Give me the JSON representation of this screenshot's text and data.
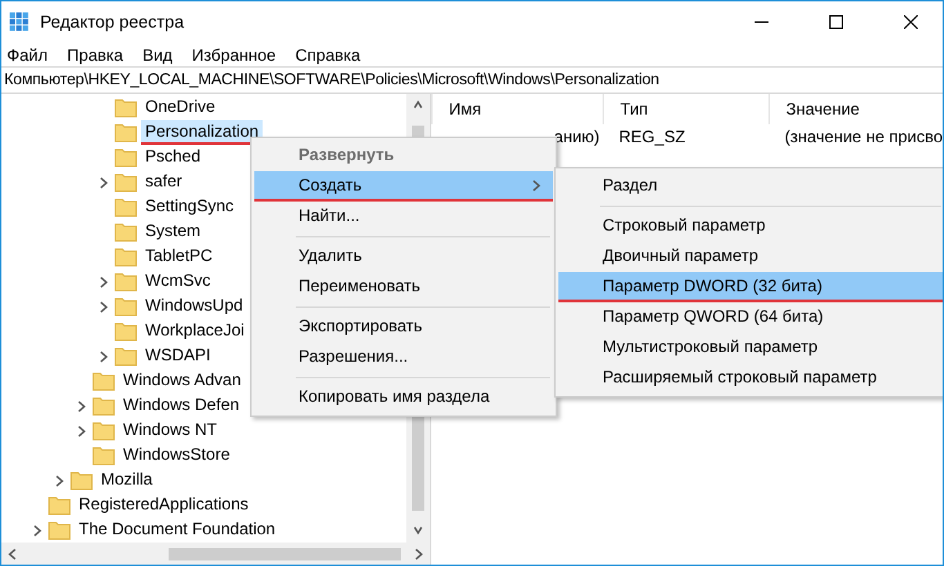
{
  "window": {
    "title": "Редактор реестра"
  },
  "menu_bar": [
    "Файл",
    "Правка",
    "Вид",
    "Избранное",
    "Справка"
  ],
  "address": "Компьютер\\HKEY_LOCAL_MACHINE\\SOFTWARE\\Policies\\Microsoft\\Windows\\Personalization",
  "tree": [
    {
      "children": [
        {
          "children": [
            {
              "children": [
                {
                  "label": "OneDrive",
                  "expandable": false,
                  "selected": false,
                  "underlined": false
                },
                {
                  "label": "Personalization",
                  "expandable": false,
                  "selected": true,
                  "underlined": true
                },
                {
                  "label": "Psched",
                  "expandable": false,
                  "selected": false,
                  "underlined": false
                },
                {
                  "label": "safer",
                  "expandable": true,
                  "selected": false,
                  "underlined": false
                },
                {
                  "label": "SettingSync",
                  "expandable": false,
                  "selected": false,
                  "underlined": false
                },
                {
                  "label": "System",
                  "expandable": false,
                  "selected": false,
                  "underlined": false
                },
                {
                  "label": "TabletPC",
                  "expandable": false,
                  "selected": false,
                  "underlined": false
                },
                {
                  "label": "WcmSvc",
                  "expandable": true,
                  "selected": false,
                  "underlined": false
                },
                {
                  "label": "WindowsUpd",
                  "expandable": true,
                  "selected": false,
                  "underlined": false
                },
                {
                  "label": "WorkplaceJoi",
                  "expandable": false,
                  "selected": false,
                  "underlined": false
                },
                {
                  "label": "WSDAPI",
                  "expandable": true,
                  "selected": false,
                  "underlined": false
                }
              ]
            },
            {
              "label": "Windows Advan",
              "expandable": false,
              "selected": false,
              "underlined": false
            },
            {
              "label": "Windows Defen",
              "expandable": true,
              "selected": false,
              "underlined": false
            },
            {
              "label": "Windows NT",
              "expandable": true,
              "selected": false,
              "underlined": false
            },
            {
              "label": "WindowsStore",
              "expandable": false,
              "selected": false,
              "underlined": false
            }
          ]
        },
        {
          "label": "Mozilla",
          "expandable": true,
          "selected": false,
          "underlined": false
        }
      ]
    },
    {
      "label": "RegisteredApplications",
      "expandable": false,
      "selected": false,
      "underlined": false
    },
    {
      "label": "The Document Foundation",
      "expandable": true,
      "selected": false,
      "underlined": false
    }
  ],
  "values_table": {
    "columns": [
      "Имя",
      "Тип",
      "Значение"
    ],
    "rows": [
      {
        "name": "анию)",
        "type": "REG_SZ",
        "value": "(значение не присво"
      }
    ]
  },
  "context_menu": [
    {
      "kind": "item",
      "label": "Развернуть",
      "default": true,
      "selected": false,
      "submenu": false,
      "underlined": false
    },
    {
      "kind": "item",
      "label": "Создать",
      "default": false,
      "selected": true,
      "submenu": true,
      "underlined": true
    },
    {
      "kind": "item",
      "label": "Найти...",
      "default": false,
      "selected": false,
      "submenu": false,
      "underlined": false
    },
    {
      "kind": "separator"
    },
    {
      "kind": "item",
      "label": "Удалить",
      "default": false,
      "selected": false,
      "submenu": false,
      "underlined": false
    },
    {
      "kind": "item",
      "label": "Переименовать",
      "default": false,
      "selected": false,
      "submenu": false,
      "underlined": false
    },
    {
      "kind": "separator"
    },
    {
      "kind": "item",
      "label": "Экспортировать",
      "default": false,
      "selected": false,
      "submenu": false,
      "underlined": false
    },
    {
      "kind": "item",
      "label": "Разрешения...",
      "default": false,
      "selected": false,
      "submenu": false,
      "underlined": false
    },
    {
      "kind": "separator"
    },
    {
      "kind": "item",
      "label": "Копировать имя раздела",
      "default": false,
      "selected": false,
      "submenu": false,
      "underlined": false
    }
  ],
  "submenu": [
    {
      "kind": "item",
      "label": "Раздел",
      "default": false,
      "selected": false,
      "submenu": false,
      "underlined": false
    },
    {
      "kind": "separator"
    },
    {
      "kind": "item",
      "label": "Строковый параметр",
      "default": false,
      "selected": false,
      "submenu": false,
      "underlined": false
    },
    {
      "kind": "item",
      "label": "Двоичный параметр",
      "default": false,
      "selected": false,
      "submenu": false,
      "underlined": false
    },
    {
      "kind": "item",
      "label": "Параметр DWORD (32 бита)",
      "default": false,
      "selected": true,
      "submenu": false,
      "underlined": true
    },
    {
      "kind": "item",
      "label": "Параметр QWORD (64 бита)",
      "default": false,
      "selected": false,
      "submenu": false,
      "underlined": false
    },
    {
      "kind": "item",
      "label": "Мультистроковый параметр",
      "default": false,
      "selected": false,
      "submenu": false,
      "underlined": false
    },
    {
      "kind": "item",
      "label": "Расширяемый строковый параметр",
      "default": false,
      "selected": false,
      "submenu": false,
      "underlined": false
    }
  ]
}
